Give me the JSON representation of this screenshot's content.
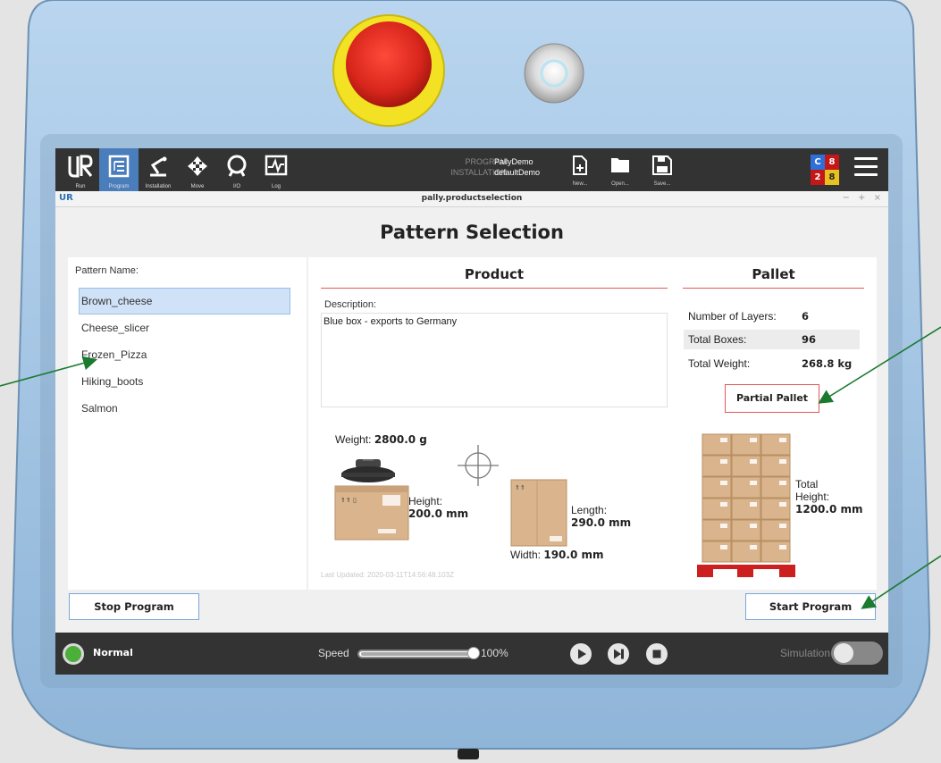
{
  "topbar": {
    "nav": [
      {
        "label": "Run",
        "icon": "ur-logo-icon"
      },
      {
        "label": "Program",
        "icon": "program-tree-icon"
      },
      {
        "label": "Installation",
        "icon": "robot-arm-icon"
      },
      {
        "label": "Move",
        "icon": "move-arrows-icon"
      },
      {
        "label": "I/O",
        "icon": "io-icon"
      },
      {
        "label": "Log",
        "icon": "log-chart-icon"
      }
    ],
    "program_key": "PROGRAM",
    "program_value": "PallyDemo",
    "installation_key": "INSTALLATION",
    "installation_value": "defaultDemo",
    "file_buttons": [
      {
        "label": "New...",
        "icon": "new-file-icon"
      },
      {
        "label": "Open...",
        "icon": "folder-icon"
      },
      {
        "label": "Save...",
        "icon": "save-icon"
      }
    ],
    "counter": {
      "c": "C",
      "v1": "8",
      "v2": "2",
      "v3": "8"
    }
  },
  "titlebar": {
    "logo": "UR",
    "title": "pally.productselection",
    "controls": "− + ×"
  },
  "page": {
    "title": "Pattern Selection",
    "pattern_label": "Pattern Name:",
    "patterns": [
      "Brown_cheese",
      "Cheese_slicer",
      "Frozen_Pizza",
      "Hiking_boots",
      "Salmon"
    ],
    "selected_pattern_index": 0
  },
  "product": {
    "heading": "Product",
    "description_label": "Description:",
    "description": "Blue box - exports to Germany",
    "weight_label": "Weight:",
    "weight": "2800.0 g",
    "height_label": "Height:",
    "height": "200.0 mm",
    "length_label": "Length:",
    "length": "290.0 mm",
    "width_label": "Width:",
    "width": "190.0 mm",
    "last_updated": "Last Updated: 2020-03-11T14:56:48.103Z"
  },
  "pallet": {
    "heading": "Pallet",
    "layers_label": "Number of Layers:",
    "layers": "6",
    "boxes_label": "Total Boxes:",
    "boxes": "96",
    "weight_label": "Total Weight:",
    "weight": "268.8 kg",
    "partial_button": "Partial Pallet",
    "total_label": "Total",
    "height_label": "Height:",
    "height": "1200.0 mm"
  },
  "actions": {
    "stop": "Stop Program",
    "start": "Start Program"
  },
  "footer": {
    "status": "Normal",
    "speed_label": "Speed",
    "speed_value": "100%",
    "speed_fraction": 1.0,
    "simulation_label": "Simulation"
  },
  "colors": {
    "accent_blue": "#4a7dbb",
    "divider_red": "#e25858",
    "status_green": "#4caf3a",
    "pallet_red": "#cc1f1f",
    "pendant_blue": "#a9c9e6"
  }
}
